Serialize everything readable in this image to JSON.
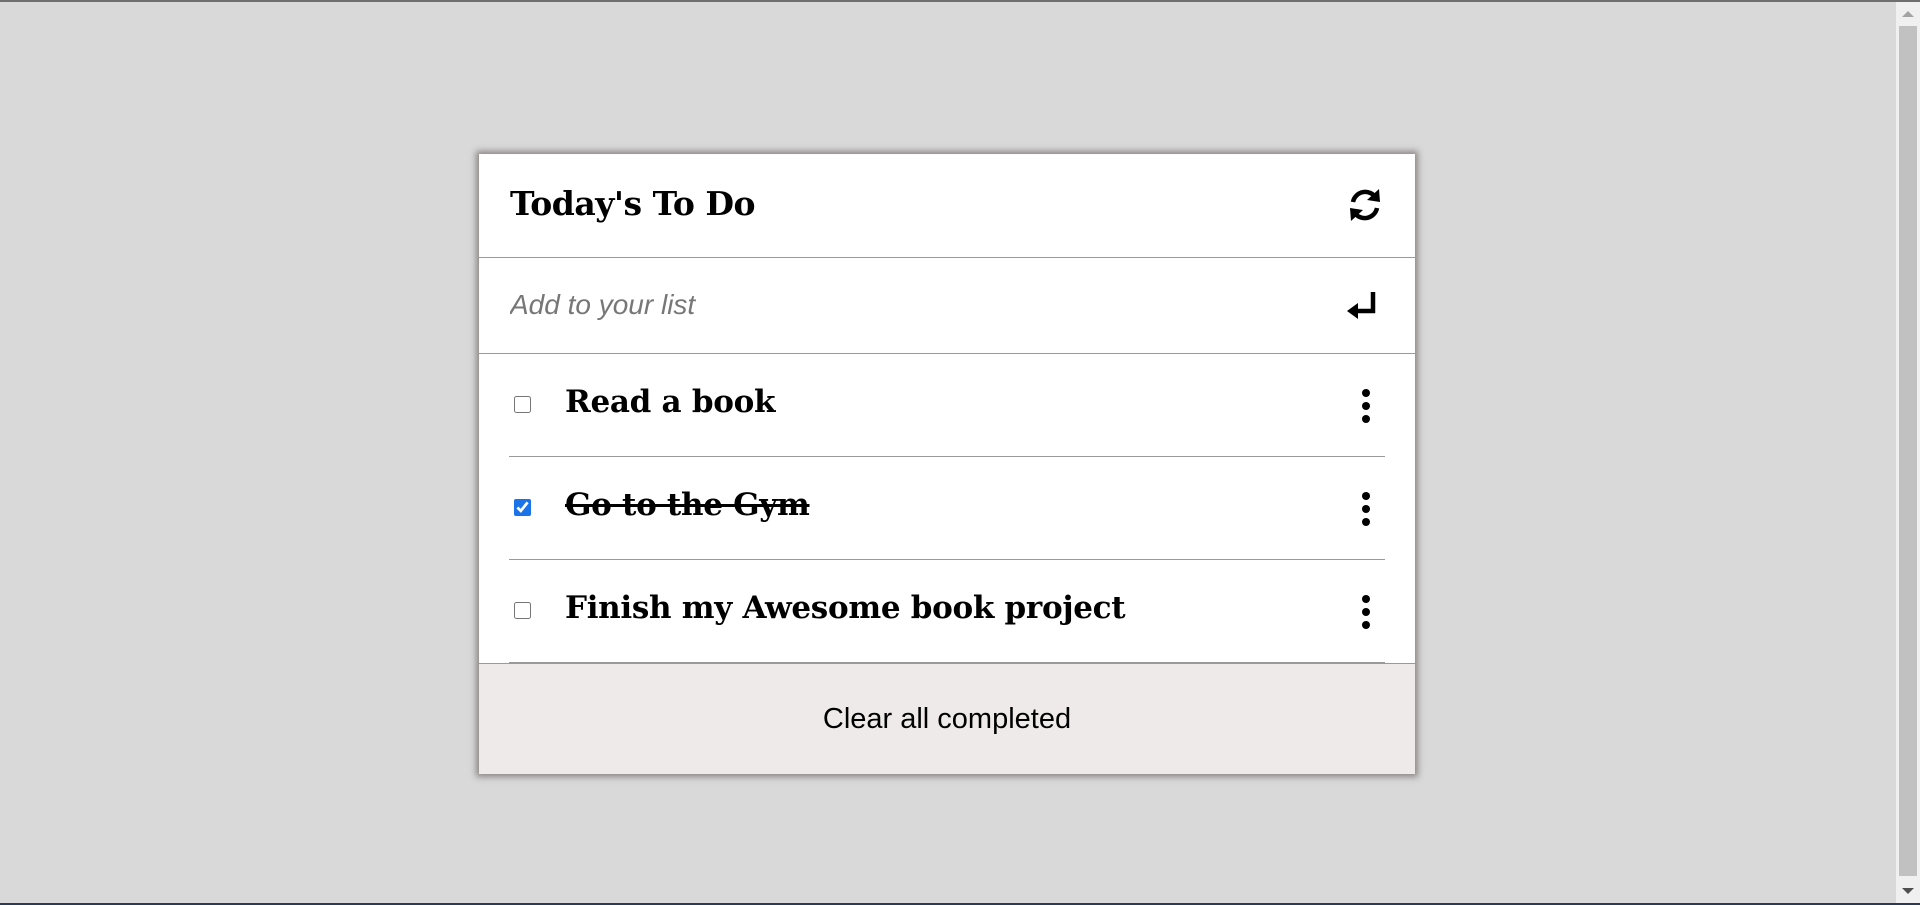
{
  "app": {
    "title": "Today's To Do",
    "refresh_icon": "refresh-icon"
  },
  "add": {
    "placeholder": "Add to your list",
    "value": "",
    "submit_icon": "enter-return-icon"
  },
  "todos": [
    {
      "label": "Read a book",
      "completed": false,
      "menu_icon": "kebab-menu-icon"
    },
    {
      "label": "Go to the Gym",
      "completed": true,
      "menu_icon": "kebab-menu-icon"
    },
    {
      "label": "Finish my Awesome book project",
      "completed": false,
      "menu_icon": "kebab-menu-icon"
    }
  ],
  "footer": {
    "clear_label": "Clear all completed"
  },
  "colors": {
    "page_background": "#d9d9d9",
    "card_background": "#ffffff",
    "footer_background": "#eeeaea",
    "checkbox_accent": "#1a73e8"
  }
}
